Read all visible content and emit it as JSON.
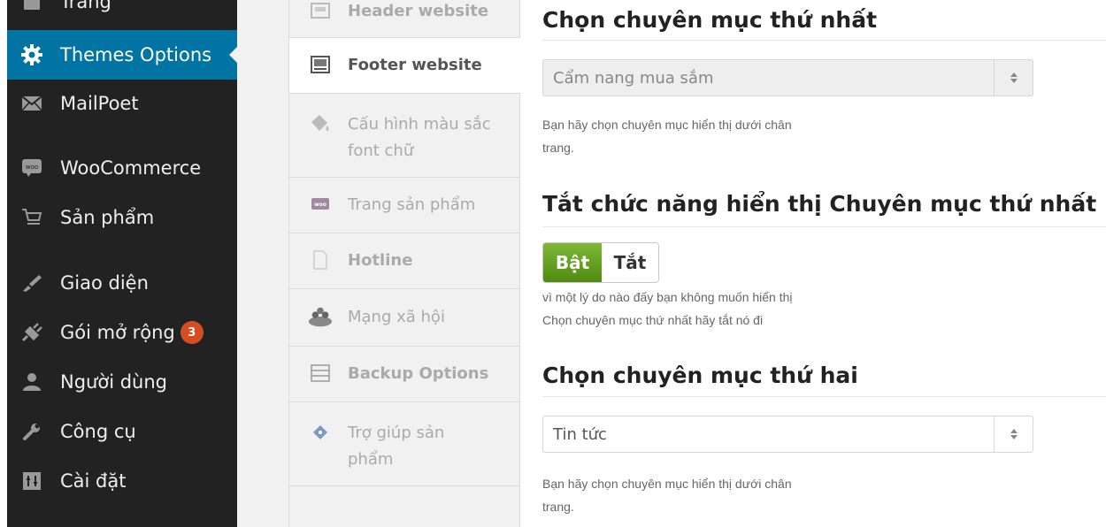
{
  "sidebar": {
    "items": [
      {
        "label": "Trang",
        "icon": "pages-icon"
      },
      {
        "label": "Themes Options",
        "icon": "gear-icon"
      },
      {
        "label": "MailPoet",
        "icon": "envelope-icon"
      },
      {
        "label": "WooCommerce",
        "icon": "woo-icon"
      },
      {
        "label": "Sản phẩm",
        "icon": "cart-icon"
      },
      {
        "label": "Giao diện",
        "icon": "paintbrush-icon"
      },
      {
        "label": "Gói mở rộng",
        "icon": "plugin-icon",
        "badge": "3"
      },
      {
        "label": "Người dùng",
        "icon": "user-icon"
      },
      {
        "label": "Công cụ",
        "icon": "wrench-icon"
      },
      {
        "label": "Cài đặt",
        "icon": "settings-icon"
      }
    ]
  },
  "tabs": [
    {
      "label": "Header website",
      "icon": "header-icon"
    },
    {
      "label": "Footer website",
      "icon": "footer-icon"
    },
    {
      "label": "Cấu hình màu sắc font chữ",
      "icon": "paint-bucket-icon"
    },
    {
      "label": "Trang sản phẩm",
      "icon": "woo-product-icon"
    },
    {
      "label": "Hotline",
      "icon": "document-icon"
    },
    {
      "label": "Mạng xã hội",
      "icon": "social-icon"
    },
    {
      "label": "Backup Options",
      "icon": "backup-icon"
    },
    {
      "label": "Trợ giúp sản phẩm",
      "icon": "help-icon"
    }
  ],
  "content": {
    "section1": {
      "title": "Chọn chuyên mục thứ nhất",
      "select_value": "Cẩm nang mua sắm",
      "desc_line1": "Bạn hãy chọn chuyên mục hiển thị dưới chân",
      "desc_line2": "trang."
    },
    "section2": {
      "title": "Tắt chức năng hiển thị Chuyên mục thứ nhất",
      "on_label": "Bật",
      "off_label": "Tắt",
      "desc_line1": "vì một lý do nào đấy bạn không muốn hiển thị",
      "desc_line2": "Chọn chuyên mục thứ nhất hãy tắt nó đi"
    },
    "section3": {
      "title": "Chọn chuyên mục thứ hai",
      "select_value": "Tin tức",
      "desc_line1": "Bạn hãy chọn chuyên mục hiển thị dưới chân",
      "desc_line2": "trang."
    }
  },
  "colors": {
    "sidebar_bg": "#222222",
    "active_blue": "#0074a2",
    "toggle_green": "#5f9a1c",
    "badge_orange": "#d54e21"
  }
}
